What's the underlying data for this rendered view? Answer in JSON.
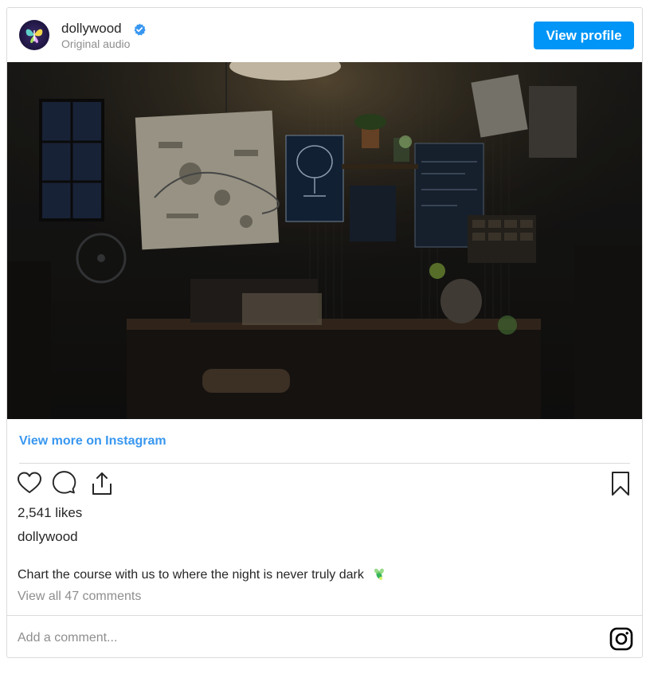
{
  "header": {
    "username": "dollywood",
    "subtitle": "Original audio",
    "view_profile_label": "View profile",
    "verified_color": "#3897f0"
  },
  "media": {
    "icon_names": [
      "lamp",
      "map",
      "blueprint",
      "desk",
      "plants",
      "window"
    ]
  },
  "links": {
    "view_more": "View more on Instagram"
  },
  "actions": {
    "icons": [
      "heart-icon",
      "comment-icon",
      "share-icon",
      "bookmark-icon"
    ]
  },
  "post": {
    "likes": "2,541 likes",
    "author": "dollywood",
    "caption": "Chart the course with us to where the night is never truly dark",
    "caption_emoji": "firefly",
    "view_comments": "View all 47 comments"
  },
  "comment_box": {
    "placeholder": "Add a comment..."
  },
  "colors": {
    "accent": "#0095f6",
    "link": "#3897f0",
    "muted": "#8e8e8e",
    "border": "#dbdbdb"
  }
}
